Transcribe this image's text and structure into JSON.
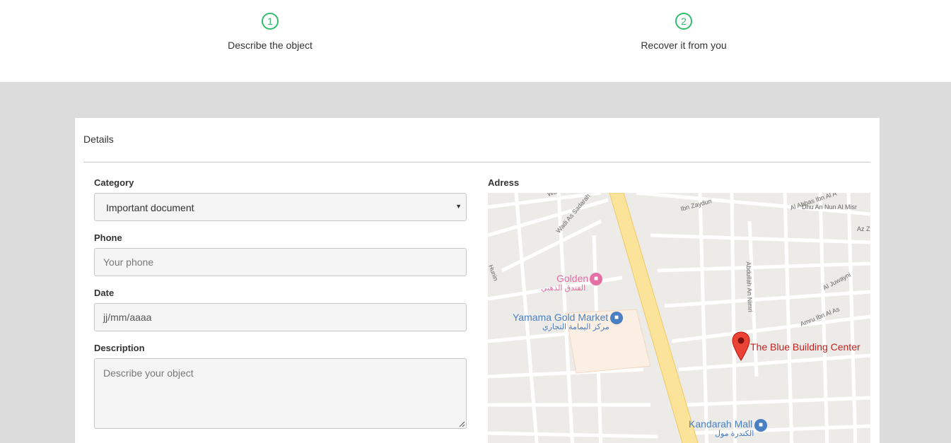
{
  "steps": [
    {
      "number": "1",
      "label": "Describe the object"
    },
    {
      "number": "2",
      "label": "Recover it from you"
    }
  ],
  "card": {
    "title": "Details"
  },
  "form": {
    "category_label": "Category",
    "category_value": "Important document",
    "phone_label": "Phone",
    "phone_placeholder": "Your phone",
    "date_label": "Date",
    "date_placeholder": "jj/mm/aaaa",
    "description_label": "Description",
    "description_placeholder": "Describe your object"
  },
  "map": {
    "label": "Adress",
    "marker_label": "The Blue Building Center",
    "places": {
      "golden": "Golden",
      "golden_ar": "الفندق الذهبي",
      "yamama": "Yamama Gold Market",
      "yamama_ar": "مركز اليمامة التجاري",
      "kandarah": "Kandarah Mall",
      "kandarah_ar": "الكندرة مول"
    },
    "streets": {
      "ibn_zaydun": "Ibn Zaydun",
      "al_abbas": "Al Abbas Ibn Al A",
      "dhu_an_nun": "Dhu An Nun Al Misr",
      "az": "Az Z",
      "wadi": "Wadi As Sadarah",
      "abdullah": "Abdullah An Nimri",
      "al_juwayni": "Al Juwayni",
      "amru": "Amru Ibn Al As",
      "hunin": "Hunin",
      "wa": "Wa"
    },
    "colors": {
      "main_road": "#fbe39a",
      "marker": "#ea4335",
      "poi_blue": "#4a7fc1",
      "poi_pink": "#e36fa5"
    }
  },
  "colors": {
    "accent": "#2ebd6b",
    "background": "#dcdcdc"
  }
}
